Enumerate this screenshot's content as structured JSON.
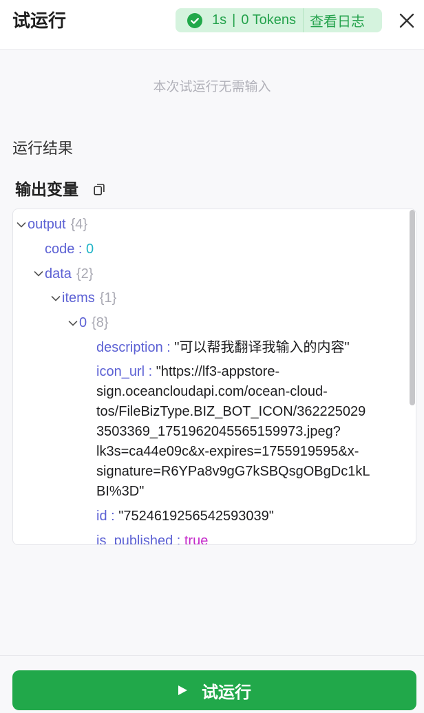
{
  "header": {
    "title": "试运行",
    "close_icon": "close-icon",
    "badge": {
      "status_icon": "check-circle-icon",
      "duration": "1s",
      "separator": "|",
      "tokens": "0 Tokens",
      "log_link": "查看日志"
    }
  },
  "input": {
    "empty_message": "本次试运行无需输入"
  },
  "result": {
    "title": "运行结果",
    "output_label": "输出变量",
    "copy_icon": "copy-icon"
  },
  "output_tree": {
    "expand_icon": "chevron-down-icon",
    "output": {
      "key": "output",
      "count": "{4}"
    },
    "code": {
      "key": "code",
      "separator": " : ",
      "value": "0"
    },
    "data": {
      "key": "data",
      "count": "{2}"
    },
    "items": {
      "key": "items",
      "count": "{1}"
    },
    "item_0": {
      "key": "0",
      "count": "{8}"
    },
    "description": {
      "key": "description",
      "separator": " : ",
      "value": "\"可以帮我翻译我输入的内容\""
    },
    "icon_url": {
      "key": "icon_url",
      "separator": " : ",
      "value_lines": [
        "\"https://lf3-appstore-",
        "sign.oceancloudapi.com/ocean-cloud-",
        "tos/FileBizType.BIZ_BOT_ICON/362225029",
        "3503369_1751962045565159973.jpeg?",
        "lk3s=ca44e09c&x-expires=1755919595&x-",
        "signature=R6YPa8v9gG7kSBQsgOBgDc1kL",
        "BI%3D\""
      ]
    },
    "id": {
      "key": "id",
      "separator": " : ",
      "value": "\"7524619256542593039\""
    },
    "is_published": {
      "key": "is_published",
      "separator": " : ",
      "value": "true"
    }
  },
  "footer": {
    "run_button": "试运行",
    "play_icon": "play-icon"
  },
  "colors": {
    "accent_green": "#21a84a",
    "badge_bg": "#d5f3de",
    "badge_text": "#24a24c",
    "key": "#5c61d4",
    "number": "#1fb3c6",
    "boolean": "#c427c9",
    "count": "#a9a9b3"
  }
}
